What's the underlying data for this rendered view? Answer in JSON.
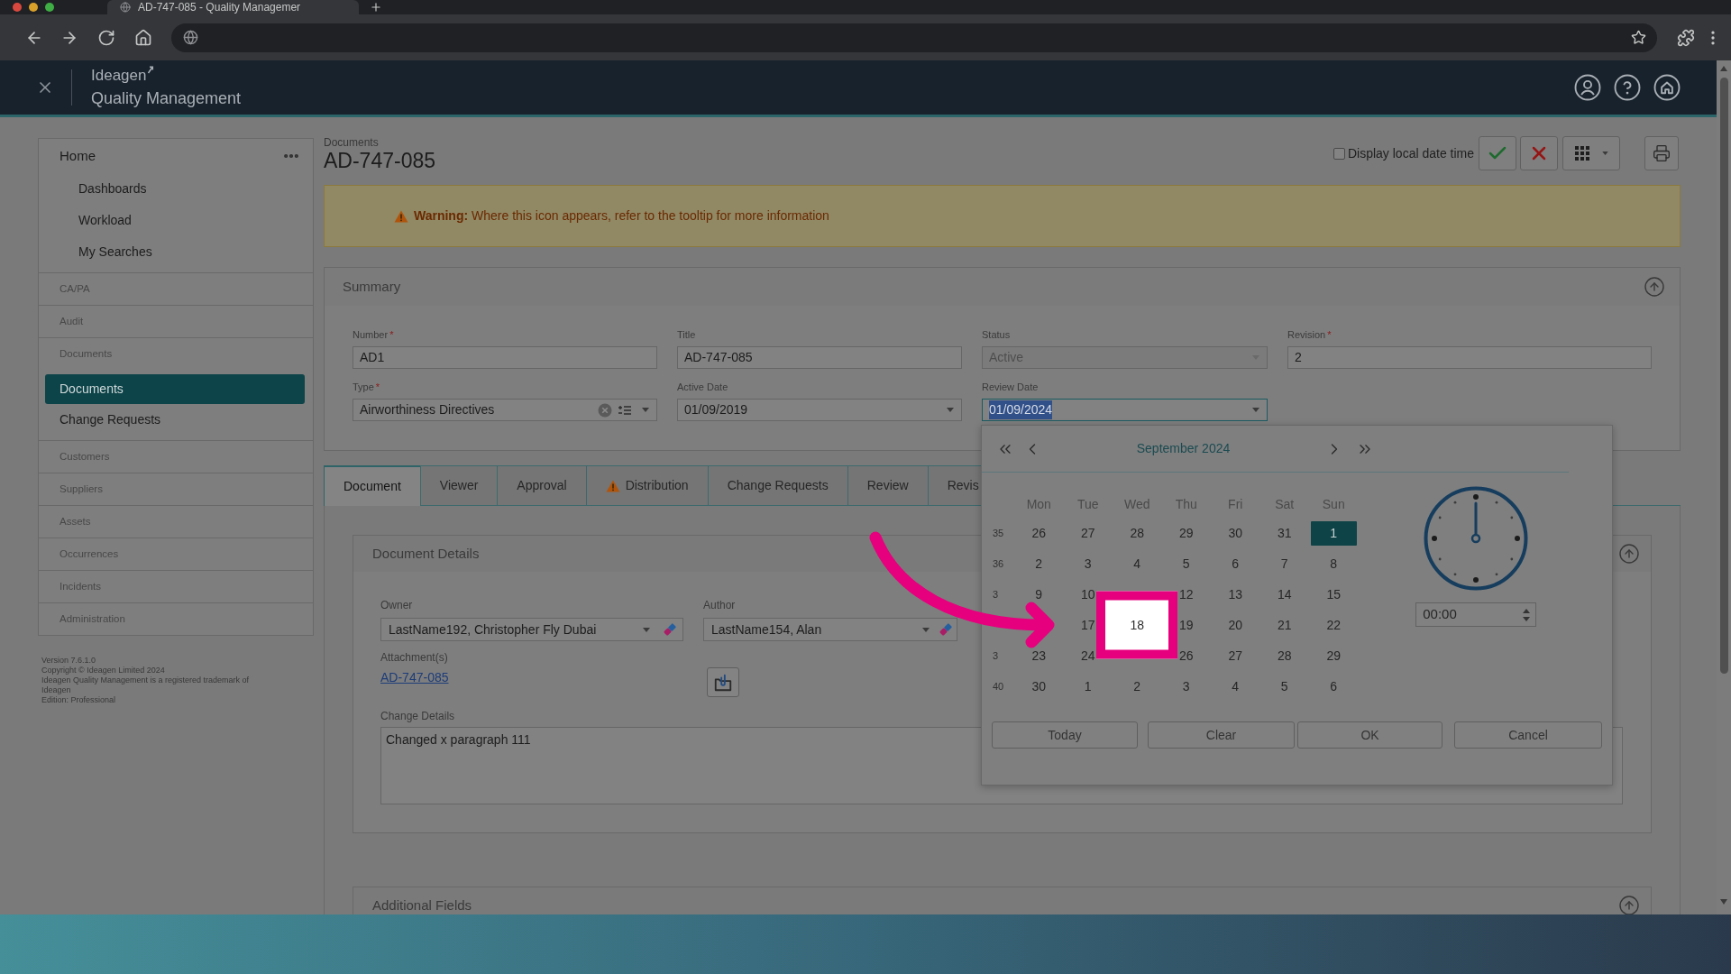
{
  "browser": {
    "tab_title": "AD-747-085 - Quality Managemer"
  },
  "app_header": {
    "brand": "Ideagen",
    "product": "Quality Management"
  },
  "sidebar": {
    "sections": [
      {
        "label": "Home",
        "kind": "home",
        "children": [
          {
            "label": "Dashboards",
            "selected": false
          },
          {
            "label": "Workload",
            "selected": false
          },
          {
            "label": "My Searches",
            "selected": false
          }
        ]
      },
      {
        "label": "CA/PA",
        "kind": "module"
      },
      {
        "label": "Audit",
        "kind": "module"
      },
      {
        "label": "Documents",
        "kind": "module",
        "children": [
          {
            "label": "Documents",
            "selected": true
          },
          {
            "label": "Change Requests",
            "selected": false
          }
        ]
      },
      {
        "label": "Customers",
        "kind": "module"
      },
      {
        "label": "Suppliers",
        "kind": "module"
      },
      {
        "label": "Assets",
        "kind": "module"
      },
      {
        "label": "Occurrences",
        "kind": "module"
      },
      {
        "label": "Incidents",
        "kind": "module"
      },
      {
        "label": "Administration",
        "kind": "module"
      }
    ],
    "footer": [
      "Version 7.6.1.0",
      "Copyright © Ideagen Limited 2024",
      "Ideagen Quality Management is a registered trademark of Ideagen",
      "Edition: Professional"
    ]
  },
  "page_header": {
    "breadcrumb": "Documents",
    "title": "AD-747-085",
    "local_time_toggle": {
      "label": "Display local date time",
      "checked": false
    }
  },
  "warning_banner": {
    "message": "**Warning:** Where this icon appears, refer to the tooltip for more information"
  },
  "summary": {
    "title": "Summary",
    "fields": [
      {
        "label": "Number",
        "required_mark": "*",
        "kind": "text",
        "value": "AD1",
        "disabled": false,
        "focused": false
      },
      {
        "label": "Title",
        "kind": "text",
        "value": "AD-747-085",
        "disabled": false,
        "focused": false
      },
      {
        "label": "Status",
        "kind": "select",
        "value": "Active",
        "disabled": true,
        "focused": false
      },
      {
        "label": "Revision",
        "required_mark": "*",
        "kind": "text",
        "value": "2",
        "disabled": false,
        "focused": false
      },
      {
        "label": "Type",
        "required_mark": "*",
        "kind": "lookup",
        "value": "Airworthiness Directives",
        "disabled": false,
        "focused": false
      },
      {
        "label": "Active Date",
        "kind": "date",
        "value": "01/09/2019",
        "disabled": false,
        "focused": false
      },
      {
        "label": "Review Date",
        "kind": "date",
        "value": "01/09/2024",
        "disabled": false,
        "focused": true
      }
    ]
  },
  "tabs": [
    {
      "label": "Document",
      "selected": true,
      "warning": false
    },
    {
      "label": "Viewer",
      "selected": false,
      "warning": false
    },
    {
      "label": "Approval",
      "selected": false,
      "warning": false
    },
    {
      "label": "Distribution",
      "selected": false,
      "warning": true
    },
    {
      "label": "Change Requests",
      "selected": false,
      "warning": false
    },
    {
      "label": "Review",
      "selected": false,
      "warning": false
    },
    {
      "label": "Revis",
      "selected": false,
      "warning": false
    }
  ],
  "document_details": {
    "title": "Document Details",
    "owner": {
      "label": "Owner",
      "value": "LastName192, Christopher Fly Dubai"
    },
    "author": {
      "label": "Author",
      "value": "LastName154, Alan"
    },
    "attachments": {
      "label": "Attachment(s)",
      "link": "AD-747-085"
    },
    "change_details": {
      "label": "Change Details",
      "value": "Changed x paragraph 111"
    }
  },
  "additional_fields": {
    "title": "Additional Fields"
  },
  "date_picker": {
    "month": "September 2024",
    "weekdays": [
      "Mon",
      "Tue",
      "Wed",
      "Thu",
      "Fri",
      "Sat",
      "Sun"
    ],
    "weeks": [
      {
        "week": "35",
        "days": [
          {
            "kind": "day",
            "label": "26",
            "selected": false,
            "highlighted": false
          },
          {
            "kind": "day",
            "label": "27",
            "selected": false,
            "highlighted": false
          },
          {
            "kind": "day",
            "label": "28",
            "selected": false,
            "highlighted": false
          },
          {
            "kind": "day",
            "label": "29",
            "selected": false,
            "highlighted": false
          },
          {
            "kind": "day",
            "label": "30",
            "selected": false,
            "highlighted": false
          },
          {
            "kind": "day",
            "label": "31",
            "selected": false,
            "highlighted": false
          },
          {
            "kind": "day",
            "label": "1",
            "selected": true,
            "highlighted": false
          }
        ]
      },
      {
        "week": "36",
        "days": [
          {
            "kind": "day",
            "label": "2",
            "selected": false,
            "highlighted": false
          },
          {
            "kind": "day",
            "label": "3",
            "selected": false,
            "highlighted": false
          },
          {
            "kind": "day",
            "label": "4",
            "selected": false,
            "highlighted": false
          },
          {
            "kind": "day",
            "label": "5",
            "selected": false,
            "highlighted": false
          },
          {
            "kind": "day",
            "label": "6",
            "selected": false,
            "highlighted": false
          },
          {
            "kind": "day",
            "label": "7",
            "selected": false,
            "highlighted": false
          },
          {
            "kind": "day",
            "label": "8",
            "selected": false,
            "highlighted": false
          }
        ]
      },
      {
        "week": "3",
        "days": [
          {
            "kind": "day",
            "label": "9",
            "selected": false,
            "highlighted": false
          },
          {
            "kind": "day",
            "label": "10",
            "selected": false,
            "highlighted": false
          },
          {
            "kind": "covered"
          },
          {
            "kind": "day",
            "label": "12",
            "selected": false,
            "highlighted": false
          },
          {
            "kind": "day",
            "label": "13",
            "selected": false,
            "highlighted": false
          },
          {
            "kind": "day",
            "label": "14",
            "selected": false,
            "highlighted": false
          },
          {
            "kind": "day",
            "label": "15",
            "selected": false,
            "highlighted": false
          }
        ]
      },
      {
        "days": [
          {
            "kind": "covered"
          },
          {
            "kind": "day",
            "label": "17",
            "selected": false,
            "highlighted": false
          },
          {
            "kind": "day",
            "label": "18",
            "selected": false,
            "highlighted": true
          },
          {
            "kind": "day",
            "label": "19",
            "selected": false,
            "highlighted": false
          },
          {
            "kind": "day",
            "label": "20",
            "selected": false,
            "highlighted": false
          },
          {
            "kind": "day",
            "label": "21",
            "selected": false,
            "highlighted": false
          },
          {
            "kind": "day",
            "label": "22",
            "selected": false,
            "highlighted": false
          }
        ]
      },
      {
        "week": "3",
        "days": [
          {
            "kind": "day",
            "label": "23",
            "selected": false,
            "highlighted": false
          },
          {
            "kind": "day",
            "label": "24",
            "selected": false,
            "highlighted": false
          },
          {
            "kind": "covered"
          },
          {
            "kind": "day",
            "label": "26",
            "selected": false,
            "highlighted": false
          },
          {
            "kind": "day",
            "label": "27",
            "selected": false,
            "highlighted": false
          },
          {
            "kind": "day",
            "label": "28",
            "selected": false,
            "highlighted": false
          },
          {
            "kind": "day",
            "label": "29",
            "selected": false,
            "highlighted": false
          }
        ]
      },
      {
        "week": "40",
        "days": [
          {
            "kind": "day",
            "label": "30",
            "selected": false,
            "highlighted": false
          },
          {
            "kind": "day",
            "label": "1",
            "selected": false,
            "highlighted": false
          },
          {
            "kind": "day",
            "label": "2",
            "selected": false,
            "highlighted": false
          },
          {
            "kind": "day",
            "label": "3",
            "selected": false,
            "highlighted": false
          },
          {
            "kind": "day",
            "label": "4",
            "selected": false,
            "highlighted": false
          },
          {
            "kind": "day",
            "label": "5",
            "selected": false,
            "highlighted": false
          },
          {
            "kind": "day",
            "label": "6",
            "selected": false,
            "highlighted": false
          }
        ]
      }
    ],
    "time": "00:00",
    "buttons": [
      "Today",
      "Clear",
      "OK",
      "Cancel"
    ]
  }
}
